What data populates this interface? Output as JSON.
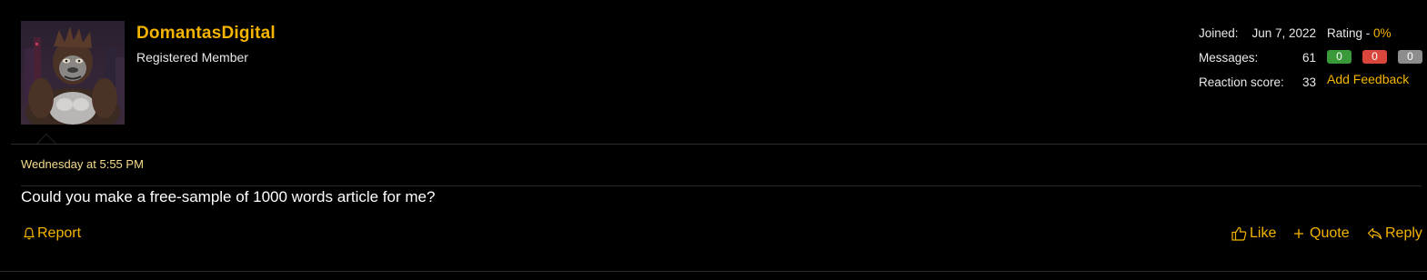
{
  "post": {
    "author": {
      "username": "DomantasDigital",
      "title": "Registered Member",
      "avatar_icon": "gorilla-avatar"
    },
    "stats": {
      "joined_label": "Joined:",
      "joined_value": "Jun 7, 2022",
      "messages_label": "Messages:",
      "messages_value": "61",
      "reaction_label": "Reaction score:",
      "reaction_value": "33"
    },
    "rating": {
      "label": "Rating - ",
      "percent": "0%",
      "positive": "0",
      "negative": "0",
      "neutral": "0",
      "add_feedback": "Add Feedback"
    },
    "date": "Wednesday at 5:55 PM",
    "message": "Could you make a free-sample of 1000 words article for me?",
    "actions": {
      "report": "Report",
      "like": "Like",
      "quote": "Quote",
      "reply": "Reply"
    }
  },
  "colors": {
    "accent": "#f5b400",
    "background": "#000000",
    "positive": "#3a9a3a",
    "negative": "#d9463b",
    "neutral": "#8d8d8d"
  }
}
